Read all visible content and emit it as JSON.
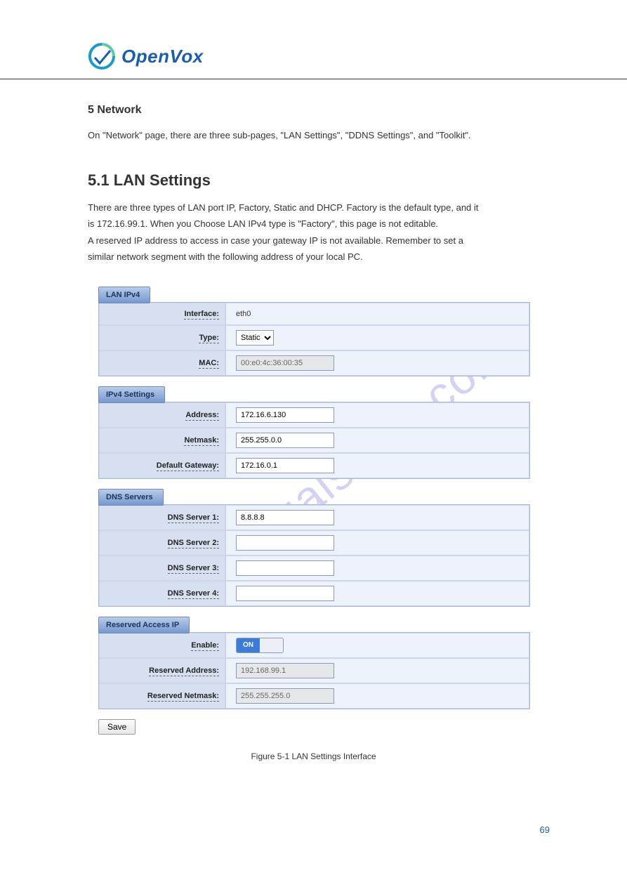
{
  "header": {
    "brand": "OpenVox"
  },
  "doc": {
    "title": "5 Network",
    "desc": "On \"Network\" page, there are three sub-pages, \"LAN Settings\", \"DDNS Settings\", and \"Toolkit\"."
  },
  "section": {
    "heading": "5.1 LAN Settings",
    "desc_line1": "There are three types of LAN port IP, Factory, Static and DHCP. Factory is the default type, and it",
    "desc_line2": "is 172.16.99.1. When you Choose LAN IPv4 type is \"Factory\", this page is not editable.",
    "desc_line3": "A reserved IP address to access in case your gateway IP is not available. Remember to set a",
    "desc_line4": "similar network segment with the following address of your local PC."
  },
  "lan_ipv4": {
    "title": "LAN IPv4",
    "rows": {
      "interface_label": "Interface:",
      "interface_value": "eth0",
      "type_label": "Type:",
      "type_value": "Static",
      "mac_label": "MAC:",
      "mac_value": "00:e0:4c:36:00:35"
    }
  },
  "ipv4_settings": {
    "title": "IPv4 Settings",
    "rows": {
      "address_label": "Address:",
      "address_value": "172.16.6.130",
      "netmask_label": "Netmask:",
      "netmask_value": "255.255.0.0",
      "gateway_label": "Default Gateway:",
      "gateway_value": "172.16.0.1"
    }
  },
  "dns": {
    "title": "DNS Servers",
    "rows": {
      "s1_label": "DNS Server 1:",
      "s1_value": "8.8.8.8",
      "s2_label": "DNS Server 2:",
      "s2_value": "",
      "s3_label": "DNS Server 3:",
      "s3_value": "",
      "s4_label": "DNS Server 4:",
      "s4_value": ""
    }
  },
  "reserved": {
    "title": "Reserved Access IP",
    "rows": {
      "enable_label": "Enable:",
      "enable_value": "ON",
      "addr_label": "Reserved Address:",
      "addr_value": "192.168.99.1",
      "mask_label": "Reserved Netmask:",
      "mask_value": "255.255.255.0"
    }
  },
  "buttons": {
    "save": "Save"
  },
  "figure_caption": "Figure 5-1  LAN Settings Interface",
  "page_number": "69",
  "watermark": "manualshive.com"
}
